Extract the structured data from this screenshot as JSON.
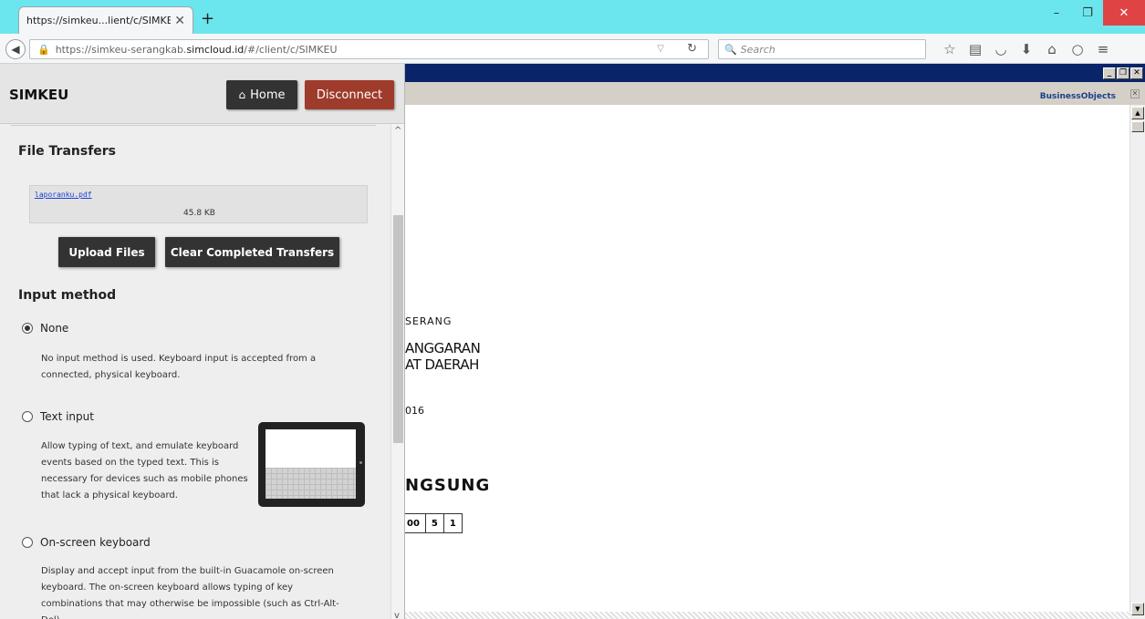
{
  "browser": {
    "tab_title": "https://simkeu...lient/c/SIMKEU",
    "tab_close": "✕",
    "new_tab": "+",
    "url_host": "https://simkeu-serangkab.",
    "url_domain": "simcloud.id",
    "url_path": "/#/client/c/SIMKEU",
    "search_placeholder": "Search",
    "window_buttons": {
      "minimize": "–",
      "restore": "❐",
      "close": "✕"
    }
  },
  "menu": {
    "app_title": "SIMKEU",
    "home_label": "Home",
    "disconnect_label": "Disconnect",
    "file_transfers": {
      "title": "File Transfers",
      "transfers": [
        {
          "filename": "laporanku.pdf",
          "size": "45.8 KB"
        }
      ],
      "upload_label": "Upload Files",
      "clear_label": "Clear Completed Transfers"
    },
    "input_method": {
      "title": "Input method",
      "selected": "None",
      "options": [
        {
          "label": "None",
          "description": "No input method is used. Keyboard input is accepted from a connected, physical keyboard."
        },
        {
          "label": "Text input",
          "description": "Allow typing of text, and emulate keyboard events based on the typed text. This is necessary for devices such as mobile phones that lack a physical keyboard."
        },
        {
          "label": "On-screen keyboard",
          "description": "Display and accept input from the built-in Guacamole on-screen keyboard. The on-screen keyboard allows typing of key combinations that may otherwise be impossible (such as Ctrl-Alt-Del)."
        }
      ]
    }
  },
  "remote": {
    "logo_part1": "Business",
    "logo_part2": "Objects",
    "report_lines": [
      "SERANG",
      "ANGGARAN",
      "AT DAERAH",
      "016",
      "NGSUNG"
    ],
    "code_boxes": [
      "00",
      "5",
      "1"
    ]
  }
}
